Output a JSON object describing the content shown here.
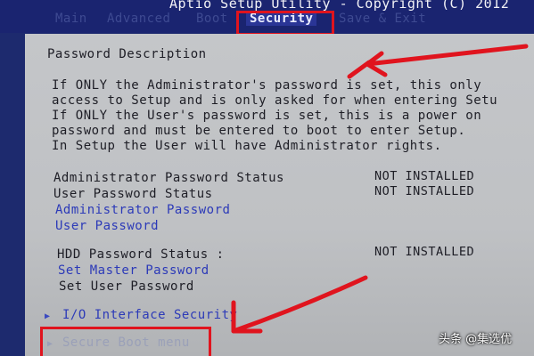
{
  "title": "Aptio Setup Utility - Copyright (C) 2012",
  "tabs": [
    {
      "label": "Main"
    },
    {
      "label": "Advanced"
    },
    {
      "label": "Boot"
    },
    {
      "label": "Security"
    },
    {
      "label": "Save & Exit"
    }
  ],
  "selected_tab": "Security",
  "section_title": "Password Description",
  "description": [
    "If ONLY the Administrator's password is set, this only",
    "access to Setup and is only asked for when entering Setu",
    "If ONLY the User's password is set, this is a power on",
    "password and must be entered to boot to enter Setup.",
    "In Setup the User will have Administrator rights."
  ],
  "status": {
    "admin_label": "Administrator Password Status",
    "admin_value": "NOT INSTALLED",
    "user_label": "User Password Status",
    "user_value": "NOT INSTALLED"
  },
  "links": {
    "admin_password": "Administrator Password",
    "user_password": "User Password"
  },
  "hdd": {
    "status_label": "HDD Password Status  :",
    "status_value": "NOT INSTALLED",
    "set_master": "Set Master Password",
    "set_user": "Set User Password"
  },
  "submenus": {
    "io_interface": "I/O Interface Security",
    "secure_boot": "Secure Boot menu"
  },
  "watermark": "头条 @集选优",
  "colors": {
    "panel_bg": "#c4c6c9",
    "header_bg": "#1a2470",
    "link_blue": "#2c3ab8",
    "annotation_red": "#e0141e"
  }
}
